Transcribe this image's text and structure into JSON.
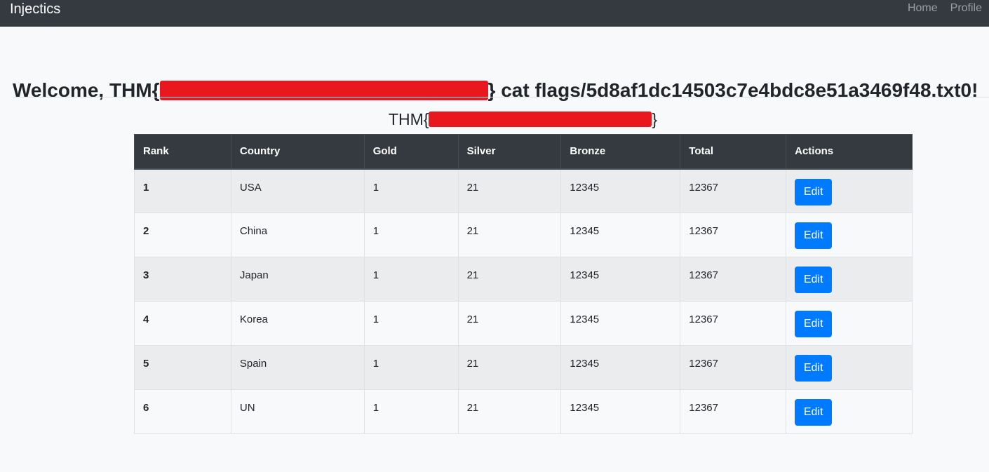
{
  "navbar": {
    "brand": "Injectics",
    "links": [
      "Home",
      "Profile"
    ]
  },
  "welcome": {
    "prefix": "Welcome, THM{",
    "suffix": "} cat flags/5d8af1dc14503c7e4bdc8e51a3469f48.txt0!"
  },
  "flag": {
    "prefix": "THM{",
    "suffix": "}"
  },
  "colors": {
    "navbar": "#343a40",
    "redaction": "#e8181e",
    "button": "#007bff"
  },
  "table": {
    "headers": [
      "Rank",
      "Country",
      "Gold",
      "Silver",
      "Bronze",
      "Total",
      "Actions"
    ],
    "rows": [
      {
        "rank": "1",
        "country": "USA",
        "gold": "1",
        "silver": "21",
        "bronze": "12345",
        "total": "12367",
        "action": "Edit"
      },
      {
        "rank": "2",
        "country": "China",
        "gold": "1",
        "silver": "21",
        "bronze": "12345",
        "total": "12367",
        "action": "Edit"
      },
      {
        "rank": "3",
        "country": "Japan",
        "gold": "1",
        "silver": "21",
        "bronze": "12345",
        "total": "12367",
        "action": "Edit"
      },
      {
        "rank": "4",
        "country": "Korea",
        "gold": "1",
        "silver": "21",
        "bronze": "12345",
        "total": "12367",
        "action": "Edit"
      },
      {
        "rank": "5",
        "country": "Spain",
        "gold": "1",
        "silver": "21",
        "bronze": "12345",
        "total": "12367",
        "action": "Edit"
      },
      {
        "rank": "6",
        "country": "UN",
        "gold": "1",
        "silver": "21",
        "bronze": "12345",
        "total": "12367",
        "action": "Edit"
      }
    ]
  }
}
